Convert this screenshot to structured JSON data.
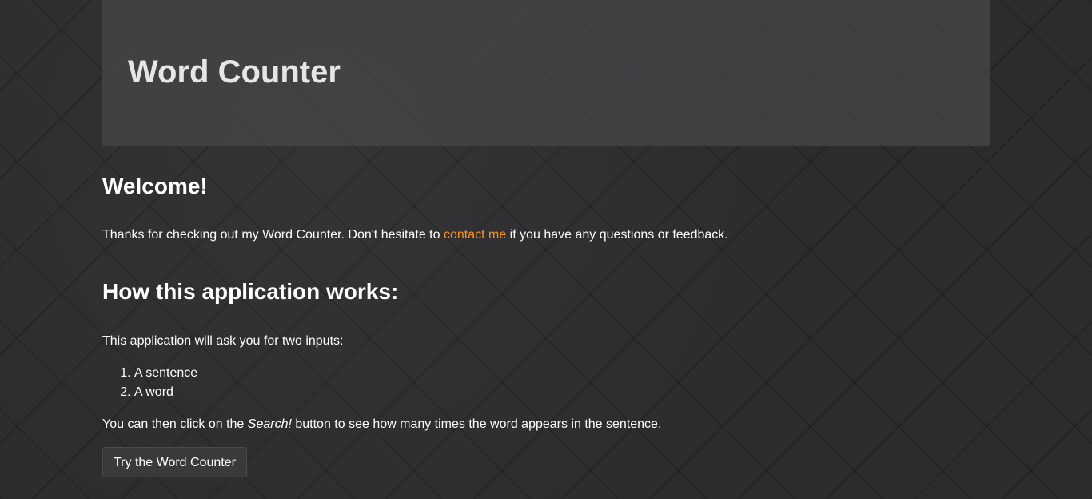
{
  "header": {
    "title": "Word Counter"
  },
  "welcome": {
    "heading": "Welcome!",
    "text_before": "Thanks for checking out my Word Counter. Don't hesitate to ",
    "link_label": "contact me",
    "text_after": " if you have any questions or feedback."
  },
  "how": {
    "heading": "How this application works:",
    "description": "This application will ask you for two inputs:",
    "inputs": [
      "A sentence",
      "A word"
    ],
    "then_before": "You can then click on the ",
    "then_emphasis": "Search!",
    "then_after": " button to see how many times the word appears in the sentence."
  },
  "cta": {
    "button_label": "Try the Word Counter"
  },
  "colors": {
    "link": "#f7941d",
    "background": "#2c2b2d",
    "jumbotron": "#48464a"
  }
}
